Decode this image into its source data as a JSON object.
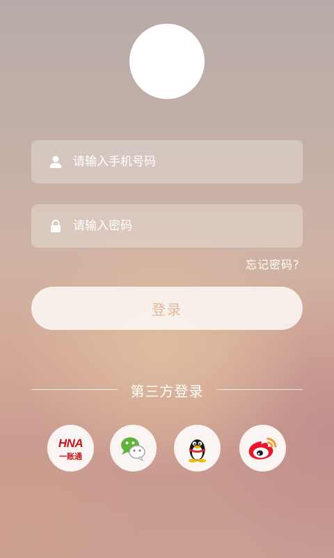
{
  "login": {
    "phone_placeholder": "请输入手机号码",
    "password_placeholder": "请输入密码",
    "forgot_password": "忘记密码？",
    "login_button": "登录"
  },
  "third_party": {
    "title": "第三方登录",
    "providers": [
      {
        "name": "hna",
        "logo_text": "HNA",
        "logo_sub": "一账通",
        "icon": "hna-logo-icon"
      },
      {
        "name": "wechat",
        "icon": "wechat-icon"
      },
      {
        "name": "qq",
        "icon": "qq-penguin-icon"
      },
      {
        "name": "weibo",
        "icon": "weibo-icon"
      }
    ]
  },
  "colors": {
    "button_text": "#e2b79f",
    "hna_red": "#c8161e",
    "wechat_green": "#5fb336",
    "weibo_red": "#e6162d"
  }
}
